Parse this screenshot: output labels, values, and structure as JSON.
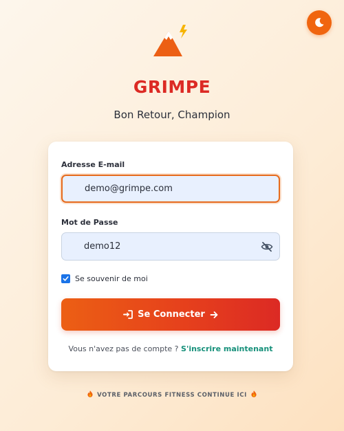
{
  "brand": {
    "name": "GRIMPE",
    "tagline": "Bon Retour, Champion",
    "logo_icon": "mountain-lightning-icon"
  },
  "theme_toggle": {
    "icon": "moon-icon"
  },
  "form": {
    "email": {
      "label": "Adresse E-mail",
      "value": "demo@grimpe.com"
    },
    "password": {
      "label": "Mot de Passe",
      "value": "demo12",
      "toggle_icon": "eye-slash-icon"
    },
    "remember": {
      "label": "Se souvenir de moi",
      "checked": true
    },
    "submit": {
      "label": "Se Connecter",
      "leading_icon": "sign-in-icon",
      "trailing_icon": "arrow-right-icon"
    },
    "signup": {
      "prompt": "Vous n'avez pas de compte ?",
      "link": "S'inscrire maintenant"
    }
  },
  "footer": {
    "text": "VOTRE PARCOURS FITNESS CONTINUE ICI",
    "icon": "fire-icon"
  },
  "colors": {
    "accent": "#f0650f",
    "brand_red": "#dc2a24",
    "link": "#16907a",
    "field_bg": "#e8f0fe"
  }
}
